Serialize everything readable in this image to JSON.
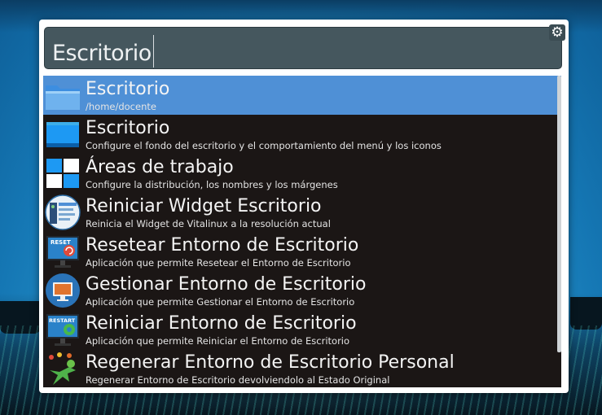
{
  "search": {
    "value": "Escritorio"
  },
  "results": [
    {
      "title": "Escritorio",
      "subtitle": "/home/docente",
      "icon": "folder-icon",
      "selected": true
    },
    {
      "title": "Escritorio",
      "subtitle": "Configure el fondo del escritorio y el comportamiento del menú y los iconos",
      "icon": "desktop-settings-icon"
    },
    {
      "title": "Áreas de trabajo",
      "subtitle": "Configure la distribución, los nombres y los márgenes",
      "icon": "workspaces-icon"
    },
    {
      "title": "Reiniciar Widget Escritorio",
      "subtitle": "Reinicia el Widget de Vitalinux a la resolución actual",
      "icon": "widget-icon"
    },
    {
      "title": "Resetear Entorno de Escritorio",
      "subtitle": "Aplicación que permite Resetear el Entorno de Escritorio",
      "icon": "reset-monitor-icon",
      "badge": "RESET"
    },
    {
      "title": "Gestionar Entorno de Escritorio",
      "subtitle": "Aplicación que permite Gestionar el Entorno de Escritorio",
      "icon": "manage-desktop-icon"
    },
    {
      "title": "Reiniciar Entorno de Escritorio",
      "subtitle": "Aplicación que permite Reiniciar el Entorno de Escritorio",
      "icon": "restart-monitor-icon",
      "badge": "RESTART"
    },
    {
      "title": "Regenerar Entorno de Escritorio Personal",
      "subtitle": "Regenerar Entorno de Escritorio devolviendolo al Estado Original",
      "icon": "regenerate-figure-icon"
    }
  ],
  "colors": {
    "selected": "#4f90d6",
    "list_bg": "#1b1615",
    "search_bg": "#45575e"
  }
}
